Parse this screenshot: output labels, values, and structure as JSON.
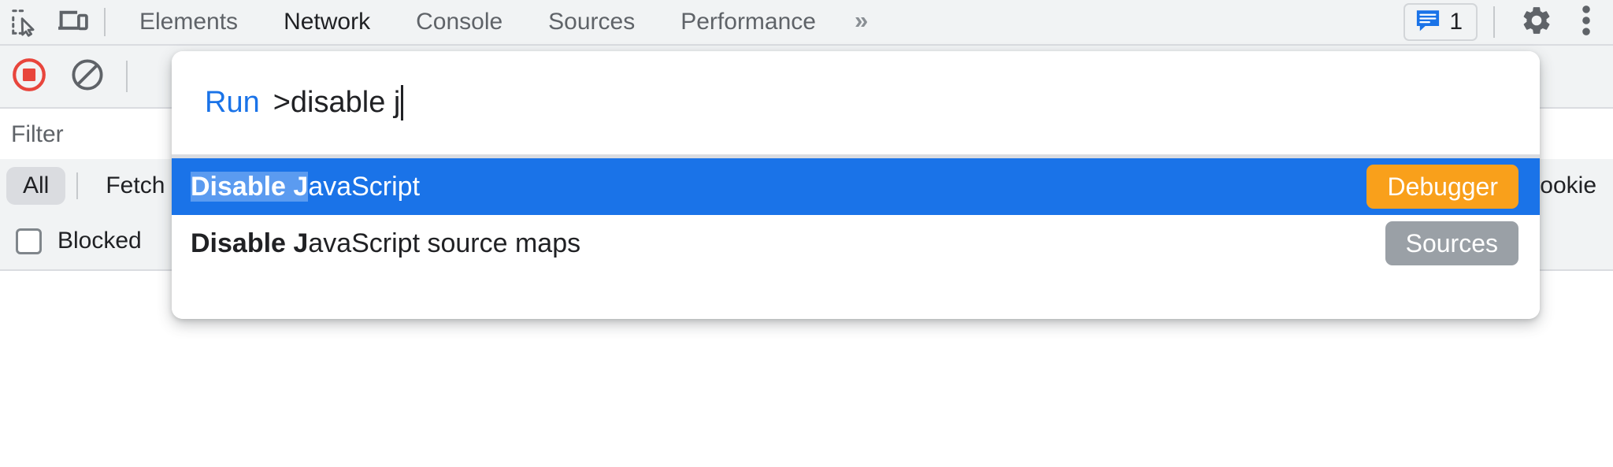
{
  "toolbar": {
    "inspect_icon": "inspect-element-icon",
    "device_icon": "device-toolbar-icon",
    "tabs": [
      {
        "label": "Elements",
        "active": false
      },
      {
        "label": "Network",
        "active": true
      },
      {
        "label": "Console",
        "active": false
      },
      {
        "label": "Sources",
        "active": false
      },
      {
        "label": "Performance",
        "active": false
      }
    ],
    "more_tabs_label": "»",
    "message_count": "1",
    "message_icon": "console-message-icon",
    "settings_icon": "gear-icon",
    "menu_icon": "vertical-dots-icon"
  },
  "network_panel": {
    "record_icon": "record-stop-icon",
    "clear_icon": "clear-network-log-icon",
    "filter_placeholder": "Filter",
    "type_chips": [
      {
        "label": "All",
        "active": true
      },
      {
        "label": "Fetch",
        "active": false
      },
      {
        "label": "ookie",
        "active": false
      }
    ],
    "blocked_label": "Blocked",
    "blocked_checked": false
  },
  "command_menu": {
    "prefix_label": "Run",
    "query_text": ">disable j",
    "results": [
      {
        "match": "Disable J",
        "rest": "avaScript",
        "badge": "Debugger",
        "badge_color": "#f9a01b",
        "selected": true
      },
      {
        "match": "Disable J",
        "rest": "avaScript source maps",
        "badge": "Sources",
        "badge_color": "#9aa0a6",
        "selected": false
      }
    ]
  },
  "colors": {
    "selection_blue": "#1a73e8",
    "match_highlight": "#5b9bf0",
    "accent_link": "#1a73e8",
    "record_red": "#e8453c",
    "panel_bg": "#f1f3f4"
  }
}
